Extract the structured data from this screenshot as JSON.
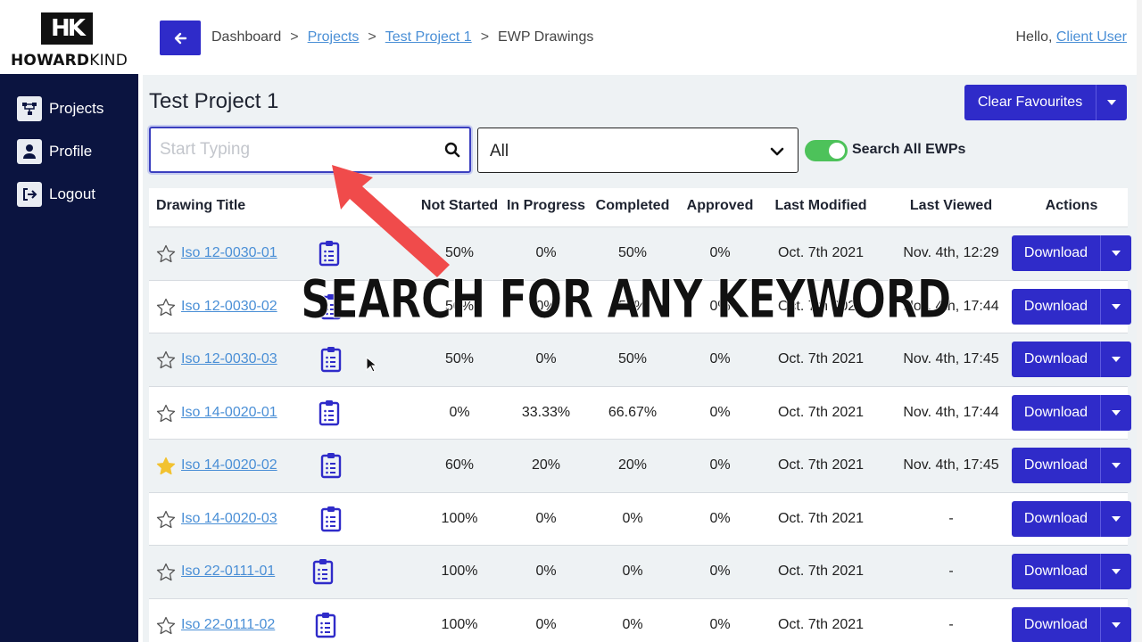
{
  "brand": {
    "mark": "HK",
    "name_bold": "HOWARD",
    "name_rest": "KIND"
  },
  "sidebar": {
    "items": [
      {
        "label": "Projects",
        "icon": "sitemap-icon"
      },
      {
        "label": "Profile",
        "icon": "user-icon"
      },
      {
        "label": "Logout",
        "icon": "logout-icon"
      }
    ]
  },
  "breadcrumb": {
    "items": [
      "Dashboard",
      "Projects",
      "Test Project 1",
      "EWP Drawings"
    ],
    "separator": ">"
  },
  "header": {
    "greeting": "Hello,",
    "user": "Client User"
  },
  "page": {
    "title": "Test Project 1",
    "clear_favourites": "Clear Favourites"
  },
  "search": {
    "placeholder": "Start Typing",
    "value": ""
  },
  "filter": {
    "selected": "All"
  },
  "toggle": {
    "label": "Search All EWPs",
    "on": true
  },
  "table": {
    "headers": {
      "title": "Drawing Title",
      "not_started": "Not Started",
      "in_progress": "In Progress",
      "completed": "Completed",
      "approved": "Approved",
      "last_modified": "Last Modified",
      "last_viewed": "Last Viewed",
      "actions": "Actions"
    },
    "download_label": "Download",
    "rows": [
      {
        "title": "Iso 12-0030-01",
        "favourite": false,
        "not_started": "50%",
        "in_progress": "0%",
        "completed": "50%",
        "approved": "0%",
        "last_modified": "Oct. 7th 2021",
        "last_viewed": "Nov. 4th, 12:29"
      },
      {
        "title": "Iso 12-0030-02",
        "favourite": false,
        "not_started": "50%",
        "in_progress": "0%",
        "completed": "50%",
        "approved": "0%",
        "last_modified": "Oct. 7th 2021",
        "last_viewed": "Nov. 4th, 17:44"
      },
      {
        "title": "Iso 12-0030-03",
        "favourite": false,
        "not_started": "50%",
        "in_progress": "0%",
        "completed": "50%",
        "approved": "0%",
        "last_modified": "Oct. 7th 2021",
        "last_viewed": "Nov. 4th, 17:45"
      },
      {
        "title": "Iso 14-0020-01",
        "favourite": false,
        "not_started": "0%",
        "in_progress": "33.33%",
        "completed": "66.67%",
        "approved": "0%",
        "last_modified": "Oct. 7th 2021",
        "last_viewed": "Nov. 4th, 17:44"
      },
      {
        "title": "Iso 14-0020-02",
        "favourite": true,
        "not_started": "60%",
        "in_progress": "20%",
        "completed": "20%",
        "approved": "0%",
        "last_modified": "Oct. 7th 2021",
        "last_viewed": "Nov. 4th, 17:45"
      },
      {
        "title": "Iso 14-0020-03",
        "favourite": false,
        "not_started": "100%",
        "in_progress": "0%",
        "completed": "0%",
        "approved": "0%",
        "last_modified": "Oct. 7th 2021",
        "last_viewed": "-"
      },
      {
        "title": "Iso 22-0111-01",
        "favourite": false,
        "not_started": "100%",
        "in_progress": "0%",
        "completed": "0%",
        "approved": "0%",
        "last_modified": "Oct. 7th 2021",
        "last_viewed": "-"
      },
      {
        "title": "Iso 22-0111-02",
        "favourite": false,
        "not_started": "100%",
        "in_progress": "0%",
        "completed": "0%",
        "approved": "0%",
        "last_modified": "Oct. 7th 2021",
        "last_viewed": "-"
      }
    ]
  },
  "annotation": {
    "text": "SEARCH FOR ANY KEYWORD",
    "arrow_color": "#f04b4b"
  },
  "colors": {
    "primary": "#2f2bc9",
    "sidebar": "#0b1440",
    "link": "#4a8fd6",
    "toggle_on": "#4dc25a",
    "star_filled": "#f2c230"
  }
}
